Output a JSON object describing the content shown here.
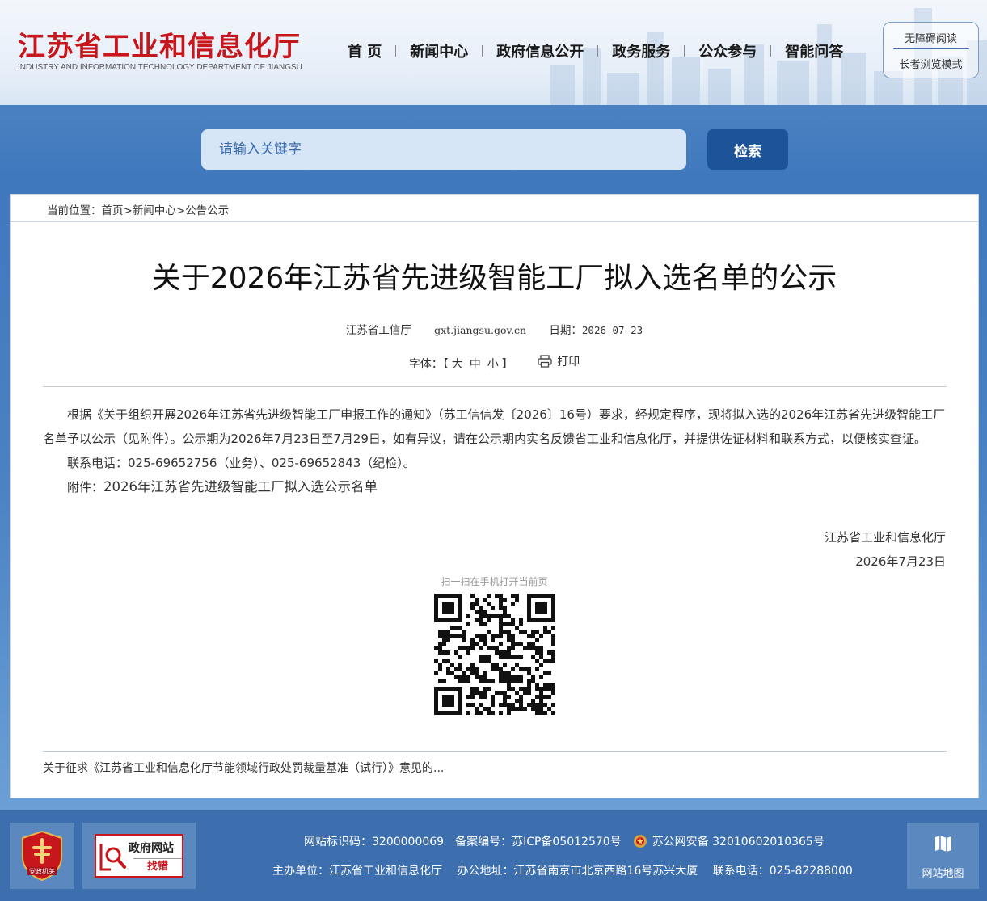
{
  "header": {
    "logo_cn": "江苏省工业和信息化厅",
    "logo_en": "INDUSTRY AND INFORMATION TECHNOLOGY DEPARTMENT OF JIANGSU",
    "nav": [
      "首 页",
      "新闻中心",
      "政府信息公开",
      "政务服务",
      "公众参与",
      "智能问答"
    ],
    "accessible_label": "无障碍阅读",
    "elder_label": "长者浏览模式"
  },
  "search": {
    "placeholder": "请输入关键字",
    "button": "检索"
  },
  "breadcrumb": {
    "prefix": "当前位置：",
    "items": [
      "首页",
      "新闻中心",
      "公告公示"
    ],
    "sep": ">"
  },
  "article": {
    "title": "关于2026年江苏省先进级智能工厂拟入选名单的公示",
    "source": "江苏省工信厅",
    "site": "gxt.jiangsu.gov.cn",
    "date_label": "日期：",
    "date": "2026-07-23",
    "font_label": "字体：【",
    "font_sizes": [
      "大",
      "中",
      "小"
    ],
    "font_close": "】",
    "print_label": "打印",
    "paragraph1": "根据《关于组织开展2026年江苏省先进级智能工厂申报工作的通知》（苏工信信发〔2026〕16号）要求，经规定程序，现将拟入选的2026年江苏省先进级智能工厂名单予以公示（见附件）。公示期为2026年7月23日至7月29日，如有异议，请在公示期内实名反馈省工业和信息化厅，并提供佐证材料和联系方式，以便核实查证。",
    "paragraph2": "联系电话：025-69652756（业务）、025-69652843（纪检）。",
    "attachment_label": "附件：",
    "attachment": "2026年江苏省先进级智能工厂拟入选公示名单",
    "sign_org": "江苏省工业和信息化厅",
    "sign_date": "2026年7月23日",
    "qr_caption": "扫一扫在手机打开当前页",
    "related": "关于征求《江苏省工业和信息化厅节能领域行政处罚裁量基准（试行）》意见的..."
  },
  "footer": {
    "party_badge": "党政机关",
    "find_error_title": "政府网站",
    "find_error_sub": "找错",
    "site_id": "网站标识码：3200000069",
    "icp": "备案编号：苏ICP备05012570号",
    "police": "苏公网安备 32010602010365号",
    "host": "主办单位：江苏省工业和信息化厅",
    "address": "办公地址：江苏省南京市北京西路16号苏兴大厦",
    "phone": "联系电话：025-82288000",
    "sitemap": "网站地图"
  },
  "colors": {
    "brand_red": "#c8161d",
    "nav_blue": "#1d5499",
    "footer_blue": "#3d6fae"
  }
}
